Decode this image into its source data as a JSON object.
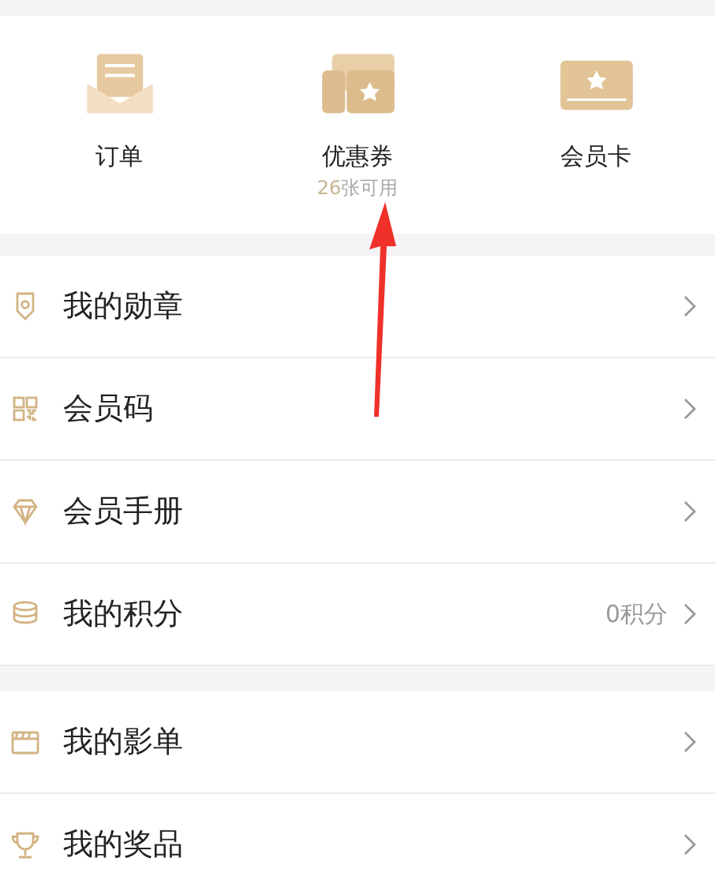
{
  "shortcuts": [
    {
      "kind": "order",
      "label": "订单"
    },
    {
      "kind": "coupon",
      "label": "优惠券",
      "count": "26",
      "count_text": "张可用"
    },
    {
      "kind": "card",
      "label": "会员卡"
    }
  ],
  "menu_groups": [
    [
      {
        "kind": "badge",
        "label": "我的勋章"
      },
      {
        "kind": "qr",
        "label": "会员码"
      },
      {
        "kind": "diamond",
        "label": "会员手册"
      },
      {
        "kind": "coins",
        "label": "我的积分",
        "value": "0积分"
      }
    ],
    [
      {
        "kind": "film",
        "label": "我的影单"
      },
      {
        "kind": "trophy",
        "label": "我的奖品"
      }
    ]
  ]
}
